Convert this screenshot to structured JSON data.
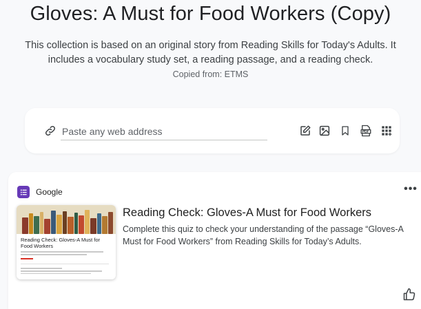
{
  "collection": {
    "title": "Gloves: A Must for Food Workers (Copy)",
    "description": "This collection is based on an original story from Reading Skills for Today's Adults. It includes a vocabulary study set, a reading passage, and a reading check.",
    "copied_from": "Copied from: ETMS"
  },
  "url_bar": {
    "placeholder": "Paste any web address",
    "icons": [
      "link-icon",
      "note-edit-icon",
      "image-icon",
      "bookmark-icon",
      "pdf-icon",
      "qr-code-icon"
    ]
  },
  "item": {
    "source": "Google",
    "source_icon": "google-forms-icon",
    "title": "Reading Check: Gloves-A Must for Food Workers",
    "description": "Complete this quiz to check your understanding of the passage “Gloves-A Must for Food Workers” from Reading Skills for Today’s Adults.",
    "thumbnail": {
      "title": "Reading Check: Gloves-A Must for Food Workers"
    },
    "more_label": "•••"
  },
  "colors": {
    "background": "#f8f9fb",
    "card": "#ffffff",
    "forms_purple": "#673ab7"
  }
}
